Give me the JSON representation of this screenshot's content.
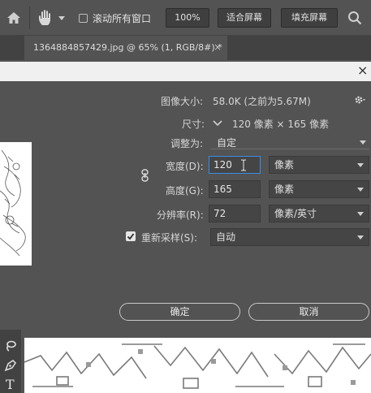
{
  "options_bar": {
    "scroll_all_label": "滚动所有窗口",
    "zoom_100_label": "100%",
    "fit_screen_label": "适合屏幕",
    "fill_screen_label": "填充屏幕"
  },
  "document_tab": {
    "title": "1364884857429.jpg @ 65% (1, RGB/8#) *",
    "close": "×"
  },
  "dialog": {
    "close": "×",
    "image_size_label": "图像大小:",
    "image_size_value": "58.0K (之前为5.67M)",
    "dimensions_label": "尺寸:",
    "dimensions_value": "120 像素 × 165 像素",
    "fit_to_label": "调整为:",
    "fit_to_value": "自定",
    "width_label": "宽度(D):",
    "width_value": "120",
    "width_unit": "像素",
    "height_label": "高度(G):",
    "height_value": "165",
    "height_unit": "像素",
    "resolution_label": "分辨率(R):",
    "resolution_value": "72",
    "resolution_unit": "像素/英寸",
    "resample_label": "重新采样(S):",
    "resample_checked": true,
    "resample_value": "自动",
    "ok_label": "确定",
    "cancel_label": "取消"
  },
  "icons": {
    "home": "home-icon",
    "hand": "hand-tool-icon",
    "search": "search-icon",
    "gear": "gear-icon",
    "link": "link-icon",
    "lasso": "lasso-icon",
    "pen": "pen-icon",
    "type": "type-tool-icon"
  },
  "toolbar": {
    "type_glyph": "T"
  },
  "colors": {
    "panel": "#535353",
    "dark": "#424242",
    "focus": "#3a8ee6",
    "titlebar": "#f0f0f0"
  }
}
